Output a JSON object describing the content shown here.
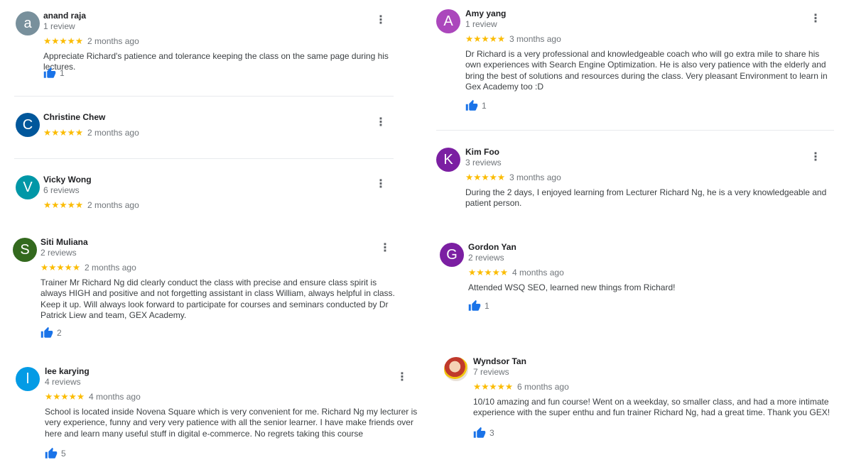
{
  "reviews": [
    {
      "initial": "a",
      "avatar_color": "#78909c",
      "name": "anand raja",
      "count": "1 review",
      "stars": "★★★★★",
      "date": "2 months ago",
      "text": "Appreciate Richard's patience and tolerance keeping the class on the same page during his lectures.",
      "likes": "1"
    },
    {
      "initial": "C",
      "avatar_color": "#01579b",
      "name": "Christine Chew",
      "count": "",
      "stars": "★★★★★",
      "date": "2 months ago",
      "text": "",
      "likes": ""
    },
    {
      "initial": "V",
      "avatar_color": "#0097a7",
      "name": "Vicky Wong",
      "count": "6 reviews",
      "stars": "★★★★★",
      "date": "2 months ago",
      "text": "",
      "likes": ""
    },
    {
      "initial": "S",
      "avatar_color": "#33691e",
      "name": "Siti Muliana",
      "count": "2 reviews",
      "stars": "★★★★★",
      "date": "2 months ago",
      "text": "Trainer Mr Richard Ng did clearly conduct the class with precise and ensure class spirit is always HIGH and positive and not forgetting assistant in class William, always helpful in class. Keep it up. Will always look forward to participate for courses and seminars conducted by Dr Patrick Liew and team, GEX Academy.",
      "likes": "2"
    },
    {
      "initial": "l",
      "avatar_color": "#039be5",
      "name": "lee karying",
      "count": "4 reviews",
      "stars": "★★★★★",
      "date": "4 months ago",
      "text": "School is located inside Novena Square which is very convenient for me. Richard Ng my lecturer is very experience, funny and very very patience with all the senior learner. I have make friends over here and learn many useful stuff in digital e-commerce. No regrets taking this course",
      "likes": "5"
    },
    {
      "initial": "A",
      "avatar_color": "#ab47bc",
      "name": "Amy yang",
      "count": "1 review",
      "stars": "★★★★★",
      "date": "3 months ago",
      "text": "Dr Richard is a very professional and knowledgeable coach who will go extra mile to share his own experiences with Search Engine Optimization. He is also very patience with the elderly and bring the best of solutions and resources during the class. Very pleasant Environment to learn in Gex Academy too :D",
      "likes": "1"
    },
    {
      "initial": "K",
      "avatar_color": "#7b1fa2",
      "name": "Kim Foo",
      "count": "3 reviews",
      "stars": "★★★★★",
      "date": "3 months ago",
      "text": "During the 2 days, I enjoyed learning from Lecturer Richard Ng, he is a very knowledgeable and patient person.",
      "likes": ""
    },
    {
      "initial": "G",
      "avatar_color": "#7b1fa2",
      "name": "Gordon Yan",
      "count": "2 reviews",
      "stars": "★★★★★",
      "date": "4 months ago",
      "text": "Attended WSQ SEO, learned new things from Richard!",
      "likes": "1"
    },
    {
      "initial": "",
      "avatar_color": "",
      "name": "Wyndsor Tan",
      "count": "7 reviews",
      "stars": "★★★★★",
      "date": "6 months ago",
      "text": "10/10 amazing and fun course! Went on a weekday, so smaller class, and had a more intimate experience with the super enthu and fun trainer Richard Ng, had a great time. Thank you GEX!",
      "likes": "3"
    }
  ]
}
